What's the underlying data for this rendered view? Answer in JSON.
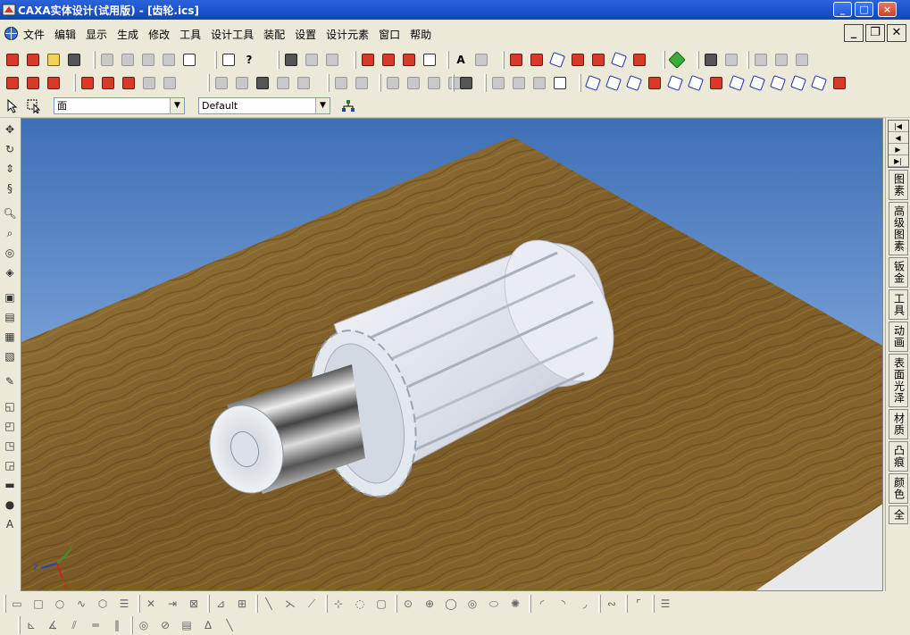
{
  "window": {
    "title": "CAXA实体设计(试用版) - [齿轮.ics]",
    "minimize": "_",
    "maximize": "□",
    "close": "×"
  },
  "menu": {
    "items": [
      "文件",
      "编辑",
      "显示",
      "生成",
      "修改",
      "工具",
      "设计工具",
      "装配",
      "设置",
      "设计元素",
      "窗口",
      "帮助"
    ],
    "mdi_minimize": "_",
    "mdi_restore": "❐",
    "mdi_close": "✕"
  },
  "selectors": {
    "filter_value": "面",
    "style_value": "Default"
  },
  "right_tabs": [
    "图素",
    "高级图素",
    "钣金",
    "工具",
    "动画",
    "表面光泽",
    "材质",
    "凸痕",
    "颜色",
    "全"
  ],
  "axis": {
    "x": "X",
    "y": "Y",
    "z": "Z"
  },
  "colors": {
    "titlebar": "#2b63d9",
    "viewport_sky": "#6a95cf",
    "wood": "#8b6a2e",
    "gear": "#e8ecf2"
  }
}
